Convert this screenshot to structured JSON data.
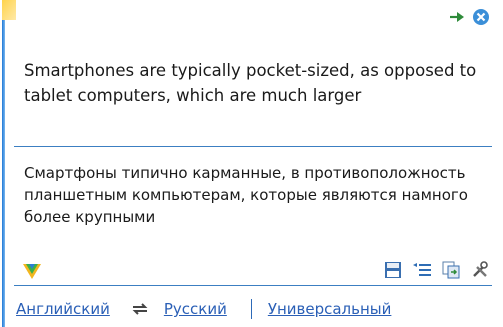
{
  "source": {
    "text": "Smartphones are typically pocket-sized, as opposed to tablet computers, which are much larger"
  },
  "translation": {
    "text": "Смартфоны типично карманные, в противоположность планшетным компьютерам, которые являются намного более крупными"
  },
  "languages": {
    "source": "Английский",
    "target": "Русский",
    "dictionary": "Универсальный"
  },
  "colors": {
    "accent": "#3c7fc2",
    "link": "#2a5fb6",
    "close": "#3b8fd8",
    "pin": "#2e8b3a"
  },
  "icons": [
    "pin-icon",
    "close-icon",
    "app-logo-icon",
    "save-icon",
    "list-icon",
    "copy-icon",
    "tools-icon",
    "swap-languages-icon"
  ]
}
